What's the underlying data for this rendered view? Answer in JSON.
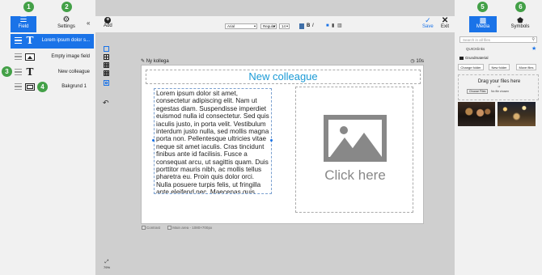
{
  "left_panel": {
    "tabs": [
      {
        "label": "Field",
        "icon": "hamburger-icon"
      },
      {
        "label": "Settings",
        "icon": "gear-icon"
      }
    ],
    "collapse_icon": "«",
    "layers": [
      {
        "label": "Lorem ipsum dolor s...",
        "kind": "text-icon",
        "glyph": "T",
        "selected": true
      },
      {
        "label": "Empty image field",
        "kind": "image-icon",
        "glyph": ""
      },
      {
        "label": "New colleague",
        "kind": "text-icon",
        "glyph": "T"
      },
      {
        "label": "Bakgrund 1",
        "kind": "background-icon",
        "glyph": ""
      }
    ]
  },
  "badges": [
    "1",
    "2",
    "3",
    "4",
    "5",
    "6"
  ],
  "toolbar": {
    "add_label": "Add",
    "add_glyph": "+",
    "font": "Arial",
    "weight": "Regular",
    "size": "14",
    "bold": "B",
    "italic": "I",
    "save_label": "Save",
    "exit_label": "Exit",
    "expand_icon": "»"
  },
  "tools": {
    "undo_glyph": "↶",
    "zoom_glyph": "⤢",
    "zoom_label": "79%"
  },
  "canvas": {
    "name": "Ny kollega",
    "duration": "10s",
    "title": "New colleague",
    "body": "Lorem ipsum dolor sit amet, consectetur adipiscing elit. Nam ut egestas diam. Suspendisse imperdiet euismod nulla id consectetur. Sed quis iaculis justo, in porta velit. Vestibulum interdum justo nulla, sed mollis magna porta non. Pellentesque ultricies vitae neque sit amet iaculis. Cras tincidunt finibus ante id facilisis. Fusce a consequat arcu, ut sagittis quam. Duis porttitor mauris nibh, ac mollis tellus pharetra eu. Proin quis dolor orci. Nulla posuere turpis felis, ut fringilla ante eleifend nec. Maecenas quis dolor ornare, scelerisque orci non, dignissim felis.",
    "image_placeholder": "Click here",
    "footer": {
      "contrast": "Contrast",
      "main_area": "Main area - 1080×700px"
    }
  },
  "right_panel": {
    "tabs": [
      {
        "label": "Media",
        "icon": "folder-icon"
      },
      {
        "label": "Symbols",
        "icon": "pentagon-icon"
      }
    ],
    "search_placeholder": "Search in all files",
    "quick_links": "QUICKlinks",
    "folder_name": "Grundmaterial",
    "buttons": [
      "Change folder",
      "New folder",
      "Move files"
    ],
    "drop_title": "Drag your files here",
    "drop_or": "or",
    "choose_files": "Choose Files",
    "no_file": "No file chosen"
  },
  "colors": {
    "accent": "#1a73e8",
    "badge": "#43a047",
    "title": "#1a9ad6"
  }
}
